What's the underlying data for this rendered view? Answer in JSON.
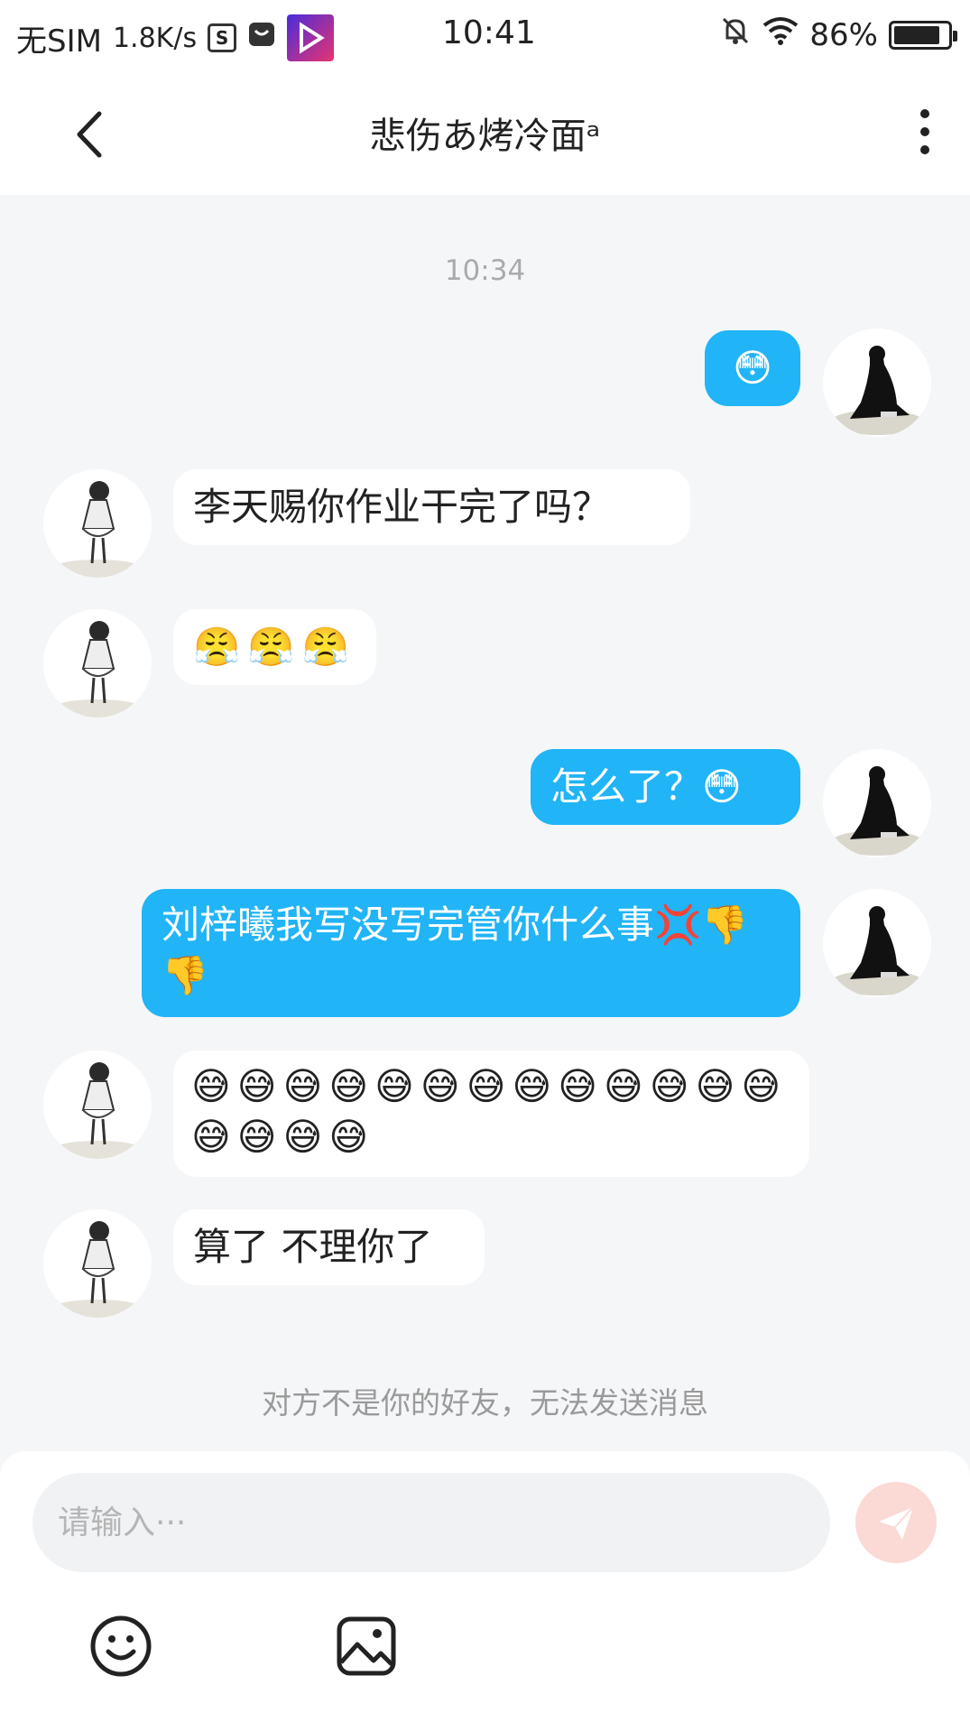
{
  "status_bar": {
    "carrier": "无SIM",
    "speed": "1.8K/s",
    "s_badge": "S",
    "time": "10:41",
    "battery": "86%",
    "battery_level": 0.86
  },
  "header": {
    "title": "悲伤あ烤冷面ᵃ"
  },
  "chat": {
    "timestamp": "10:34",
    "messages": [
      {
        "side": "out",
        "text": "😳"
      },
      {
        "side": "in",
        "text": "李天赐你作业干完了吗？"
      },
      {
        "side": "in",
        "text": "😤😤😤"
      },
      {
        "side": "out",
        "text": "怎么了？😳"
      },
      {
        "side": "out",
        "text": "刘梓曦我写没写完管你什么事💢👎👎"
      },
      {
        "side": "in",
        "text": "😅😅😅😅😅😅😅😅😅😅😅😅😅😅😅😅😅"
      },
      {
        "side": "in",
        "text": "算了 不理你了"
      }
    ],
    "notice": "对方不是你的好友，无法发送消息"
  },
  "input": {
    "placeholder": "请输入···",
    "value": ""
  },
  "icons": {
    "back": "chevron-left-icon",
    "more": "more-vertical-icon",
    "send": "paper-plane-icon",
    "emoji": "smiley-icon",
    "image": "image-icon"
  },
  "colors": {
    "outgoing_bubble": "#21b4f6",
    "incoming_bubble": "#ffffff",
    "background": "#f5f6f8",
    "send_button": "#fbd9d5"
  }
}
